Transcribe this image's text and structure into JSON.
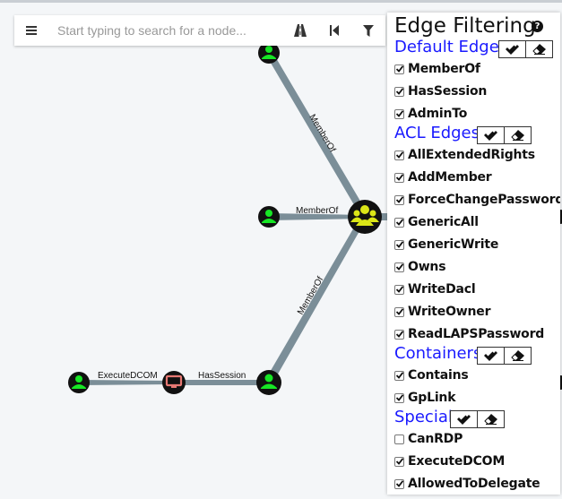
{
  "search": {
    "menu_icon": "hamburger-icon",
    "placeholder": "Start typing to search for a node...",
    "path_icon": "road-icon",
    "back_icon": "step-backward-icon",
    "filter_icon": "filter-icon"
  },
  "graph": {
    "edges": {
      "memberof_1": "MemberOf",
      "memberof_2": "MemberOf",
      "memberof_3": "MemberOf",
      "executedcom": "ExecuteDCOM",
      "hassession": "HasSession"
    },
    "colors": {
      "user_node": "#17e625",
      "group_node": "#dbe617",
      "computer_node": "#e67873",
      "edge": "#7b8e98"
    }
  },
  "panel": {
    "title": "Edge Filtering",
    "help_icon": "question-circle-icon",
    "sections": [
      {
        "title": "Default Edges",
        "items": [
          {
            "label": "MemberOf",
            "checked": true
          },
          {
            "label": "HasSession",
            "checked": true
          },
          {
            "label": "AdminTo",
            "checked": true
          }
        ]
      },
      {
        "title": "ACL Edges",
        "items": [
          {
            "label": "AllExtendedRights",
            "checked": true
          },
          {
            "label": "AddMember",
            "checked": true
          },
          {
            "label": "ForceChangePassword",
            "checked": true
          },
          {
            "label": "GenericAll",
            "checked": true
          },
          {
            "label": "GenericWrite",
            "checked": true
          },
          {
            "label": "Owns",
            "checked": true
          },
          {
            "label": "WriteDacl",
            "checked": true
          },
          {
            "label": "WriteOwner",
            "checked": true
          },
          {
            "label": "ReadLAPSPassword",
            "checked": true
          }
        ]
      },
      {
        "title": "Containers",
        "items": [
          {
            "label": "Contains",
            "checked": true
          },
          {
            "label": "GpLink",
            "checked": true
          }
        ]
      },
      {
        "title": "Special",
        "items": [
          {
            "label": "CanRDP",
            "checked": false
          },
          {
            "label": "ExecuteDCOM",
            "checked": true
          },
          {
            "label": "AllowedToDelegate",
            "checked": true
          }
        ]
      }
    ],
    "check_all_icon": "check-double-icon",
    "clear_icon": "eraser-icon"
  }
}
